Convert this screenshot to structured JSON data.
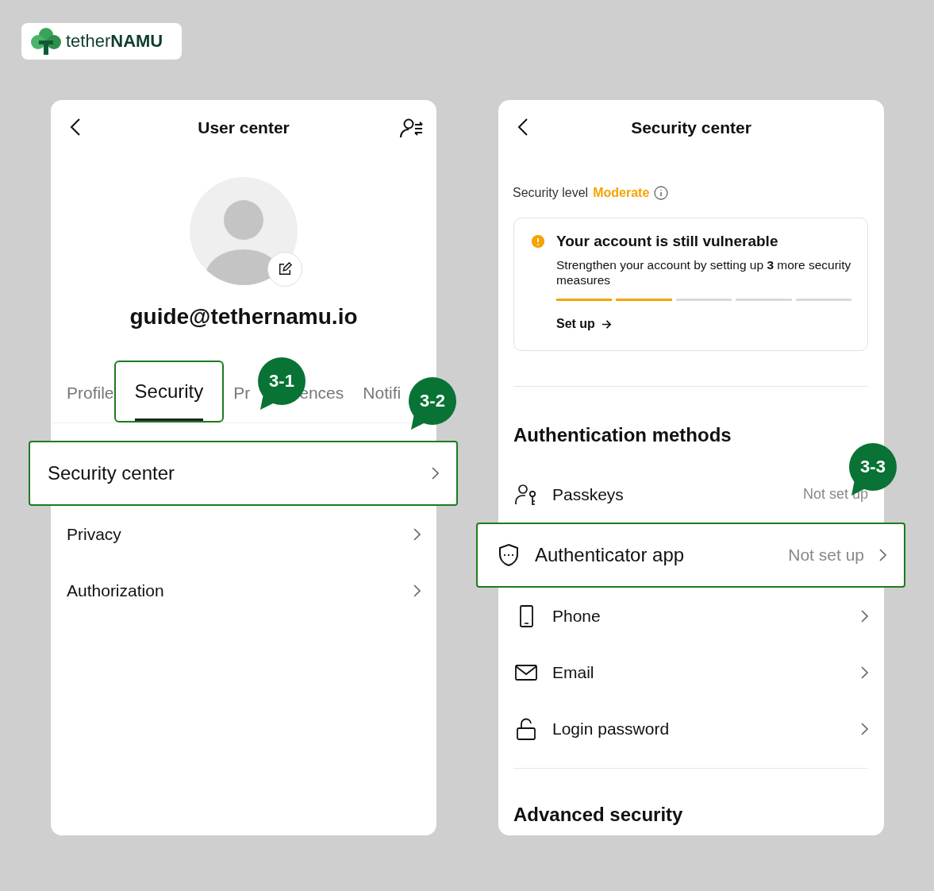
{
  "logo": {
    "text_light": "tether",
    "text_bold": "NAMU"
  },
  "user_center": {
    "title": "User center",
    "email": "guide@tethernamu.io",
    "tabs": [
      {
        "label": "Profile",
        "selected": false,
        "highlight": false
      },
      {
        "label": "Security",
        "selected": true,
        "highlight": true
      },
      {
        "label": "Pr",
        "label_tail": "ences",
        "selected": false,
        "highlight": false
      },
      {
        "label": "Notifi",
        "selected": false,
        "highlight": false
      }
    ],
    "rows": [
      {
        "label": "Security center",
        "highlight": true
      },
      {
        "label": "Privacy",
        "highlight": false
      },
      {
        "label": "Authorization",
        "highlight": false
      }
    ]
  },
  "security_center": {
    "title": "Security center",
    "level_label": "Security level",
    "level_value": "Moderate",
    "alert": {
      "title": "Your account is still vulnerable",
      "text": "Strengthen your account by setting up **3** more security measures",
      "segments": [
        {
          "filled": true
        },
        {
          "filled": true
        },
        {
          "filled": false
        },
        {
          "filled": false
        },
        {
          "filled": false
        }
      ],
      "action": "Set up"
    },
    "auth_heading": "Authentication methods",
    "methods": [
      {
        "kind": "passkey",
        "label": "Passkeys",
        "status": "Not set up",
        "highlight": false,
        "chevron": false
      },
      {
        "kind": "authenticator",
        "label": "Authenticator app",
        "status": "Not set up",
        "highlight": true,
        "chevron": true
      },
      {
        "kind": "phone",
        "label": "Phone",
        "highlight": false,
        "chevron": true
      },
      {
        "kind": "email",
        "label": "Email",
        "highlight": false,
        "chevron": true
      },
      {
        "kind": "password",
        "label": "Login password",
        "highlight": false,
        "chevron": true
      }
    ],
    "advanced_heading": "Advanced security"
  },
  "badges": [
    {
      "label": "3-1"
    },
    {
      "label": "3-2"
    },
    {
      "label": "3-3"
    }
  ]
}
